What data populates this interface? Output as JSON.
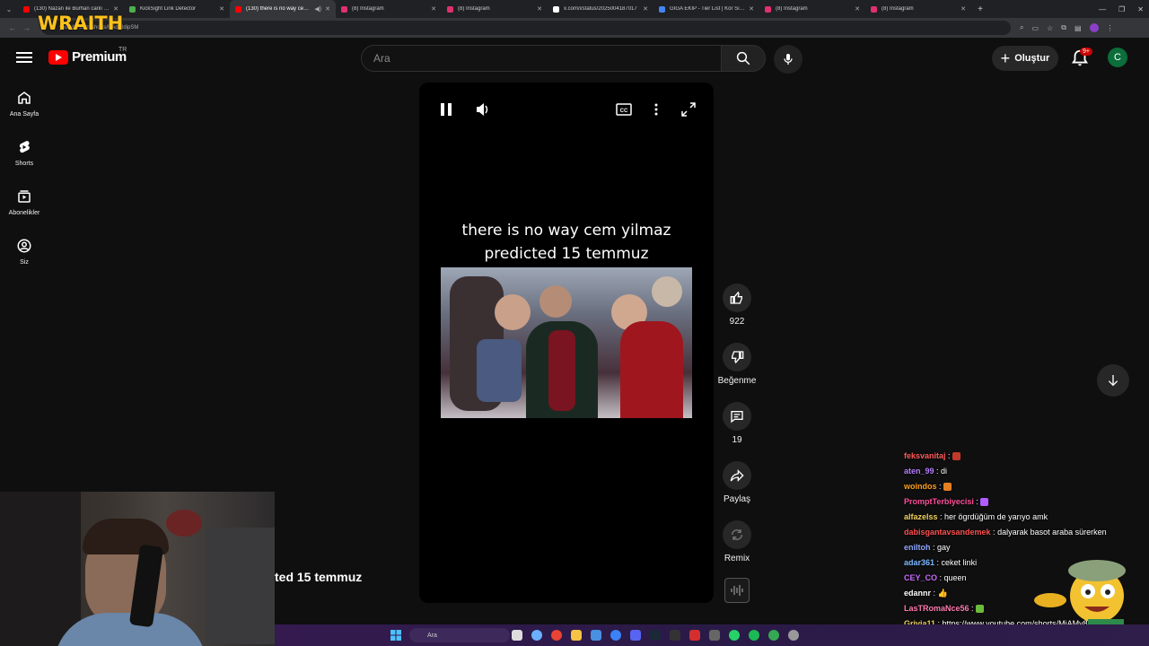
{
  "browser": {
    "tabs": [
      {
        "title": "(130) Nazan ile Burhan canlı yayın",
        "color": "#ff0000",
        "active": false
      },
      {
        "title": "KickSight Link Detector",
        "color": "#4caf50",
        "active": false
      },
      {
        "title": "(130) there is no way cem y",
        "color": "#ff0000",
        "active": true
      },
      {
        "title": "(8) Instagram",
        "color": "#e1306c",
        "active": false
      },
      {
        "title": "(8) Instagram",
        "color": "#e1306c",
        "active": false
      },
      {
        "title": "x.com/i/status/2025004187017",
        "color": "#ffffff",
        "active": false
      },
      {
        "title": "GİGA EKİP - Tier List | Kör Sıralama",
        "color": "#4285f4",
        "active": false
      },
      {
        "title": "(8) Instagram",
        "color": "#e1306c",
        "active": false
      },
      {
        "title": "(8) Instagram",
        "color": "#e1306c",
        "active": false
      }
    ],
    "url": "youtube.com/shorts/RAdVIdipSM"
  },
  "overlay": {
    "streamer_logo": "WRAITH"
  },
  "masthead": {
    "logo_text": "Premium",
    "country": "TR",
    "search_placeholder": "Ara",
    "create_label": "Oluştur",
    "notification_count": "9+",
    "avatar_letter": "C"
  },
  "guide": {
    "items": [
      {
        "label": "Ana Sayfa",
        "icon": "home-icon"
      },
      {
        "label": "Shorts",
        "icon": "shorts-icon"
      },
      {
        "label": "Abonelikler",
        "icon": "subscriptions-icon"
      },
      {
        "label": "Siz",
        "icon": "you-icon"
      }
    ]
  },
  "short": {
    "caption_line1": "there is no way cem yilmaz",
    "caption_line2": "predicted 15 temmuz",
    "title_fragment": "ted 15 temmuz",
    "actions": {
      "like_count": "922",
      "dislike_label": "Beğenme",
      "comment_count": "19",
      "share_label": "Paylaş",
      "remix_label": "Remix"
    }
  },
  "chat": {
    "messages": [
      {
        "user": "feksvanitaj",
        "text": "",
        "color": "#ff5a5a",
        "emote": "#c0392b"
      },
      {
        "user": "aten_99",
        "text": "di",
        "color": "#b67dff",
        "emote": ""
      },
      {
        "user": "woindos",
        "text": "",
        "color": "#ff9f1a",
        "emote": "#e67e22"
      },
      {
        "user": "PromptTerbiyecisi",
        "text": "",
        "color": "#ff4f9a",
        "emote": "#b05cff"
      },
      {
        "user": "alfazelss",
        "text": "her ögrdüğüm de yarıyo amk",
        "color": "#f0d060",
        "emote": ""
      },
      {
        "user": "dabisgantavsandemek",
        "text": "dalyarak basot araba sürerken",
        "color": "#ff4f4f",
        "emote": ""
      },
      {
        "user": "eniltoh",
        "text": "gay",
        "color": "#8fa8ff",
        "emote": ""
      },
      {
        "user": "adar361",
        "text": "ceket linki",
        "color": "#7db8ff",
        "emote": ""
      },
      {
        "user": "CEY_CO",
        "text": "queen",
        "color": "#c86bff",
        "emote": ""
      },
      {
        "user": "edannr",
        "text": "👍",
        "color": "#ffffff",
        "emote": ""
      },
      {
        "user": "LasTRomaNce56",
        "text": "",
        "color": "#ff7ab0",
        "emote": "#6dbb3a"
      },
      {
        "user": "Grivia11",
        "text": "https://www.youtube.com/shorts/MjAMv8r6emM",
        "color": "#f0d060",
        "emote": ""
      }
    ]
  },
  "taskbar": {
    "search_placeholder": "Ara"
  }
}
